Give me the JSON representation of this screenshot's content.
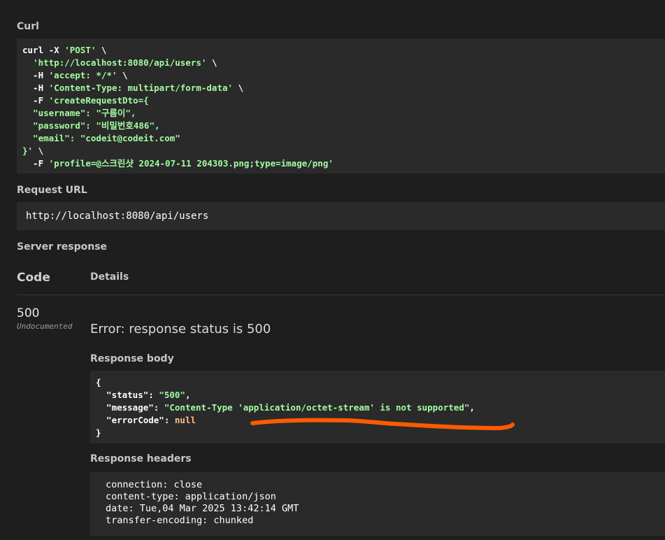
{
  "curl": {
    "title": "Curl",
    "lines": [
      [
        {
          "t": "curl -X ",
          "c": "key"
        },
        {
          "t": "'POST'",
          "c": "str"
        },
        {
          "t": " \\",
          "c": "key"
        }
      ],
      [
        {
          "t": "  ",
          "c": "key"
        },
        {
          "t": "'http://localhost:8080/api/users'",
          "c": "str"
        },
        {
          "t": " \\",
          "c": "key"
        }
      ],
      [
        {
          "t": "  -H ",
          "c": "key"
        },
        {
          "t": "'accept: */*'",
          "c": "str"
        },
        {
          "t": " \\",
          "c": "key"
        }
      ],
      [
        {
          "t": "  -H ",
          "c": "key"
        },
        {
          "t": "'Content-Type: multipart/form-data'",
          "c": "str"
        },
        {
          "t": " \\",
          "c": "key"
        }
      ],
      [
        {
          "t": "  -F ",
          "c": "key"
        },
        {
          "t": "'createRequestDto={",
          "c": "str"
        }
      ],
      [
        {
          "t": "  \"username\": \"구름이\",",
          "c": "str"
        }
      ],
      [
        {
          "t": "  \"password\": \"비밀번호486\",",
          "c": "str"
        }
      ],
      [
        {
          "t": "  \"email\": \"codeit@codeit.com\"",
          "c": "str"
        }
      ],
      [
        {
          "t": "}'",
          "c": "str"
        },
        {
          "t": " \\",
          "c": "key"
        }
      ],
      [
        {
          "t": "  -F ",
          "c": "key"
        },
        {
          "t": "'profile=@스크린샷 2024-07-11 204303.png;type=image/png'",
          "c": "str"
        }
      ]
    ]
  },
  "request_url": {
    "title": "Request URL",
    "value": "http://localhost:8080/api/users"
  },
  "server_response": {
    "title": "Server response",
    "col_code": "Code",
    "col_details": "Details",
    "code": "500",
    "undocumented": "Undocumented",
    "error": "Error: response status is 500",
    "body_title": "Response body",
    "body_lines": [
      [
        {
          "t": "{",
          "c": "key"
        }
      ],
      [
        {
          "t": "  \"status\"",
          "c": "key"
        },
        {
          "t": ": ",
          "c": "key"
        },
        {
          "t": "\"500\"",
          "c": "str"
        },
        {
          "t": ",",
          "c": "key"
        }
      ],
      [
        {
          "t": "  \"message\"",
          "c": "key"
        },
        {
          "t": ": ",
          "c": "key"
        },
        {
          "t": "\"Content-Type 'application/octet-stream' is not supported\"",
          "c": "str"
        },
        {
          "t": ",",
          "c": "key"
        }
      ],
      [
        {
          "t": "  \"errorCode\"",
          "c": "key"
        },
        {
          "t": ": ",
          "c": "key"
        },
        {
          "t": "null",
          "c": "nul"
        }
      ],
      [
        {
          "t": "}",
          "c": "key"
        }
      ]
    ],
    "headers_title": "Response headers",
    "headers": [
      "connection: close",
      "content-type: application/json",
      "date: Tue,04 Mar 2025 13:42:14 GMT",
      "transfer-encoding: chunked"
    ]
  },
  "colors": {
    "background": "#1e1e1e",
    "block": "#2a2a2a",
    "string": "#a2fca2",
    "null": "#fcc28c",
    "annotation": "#ff5a00"
  }
}
